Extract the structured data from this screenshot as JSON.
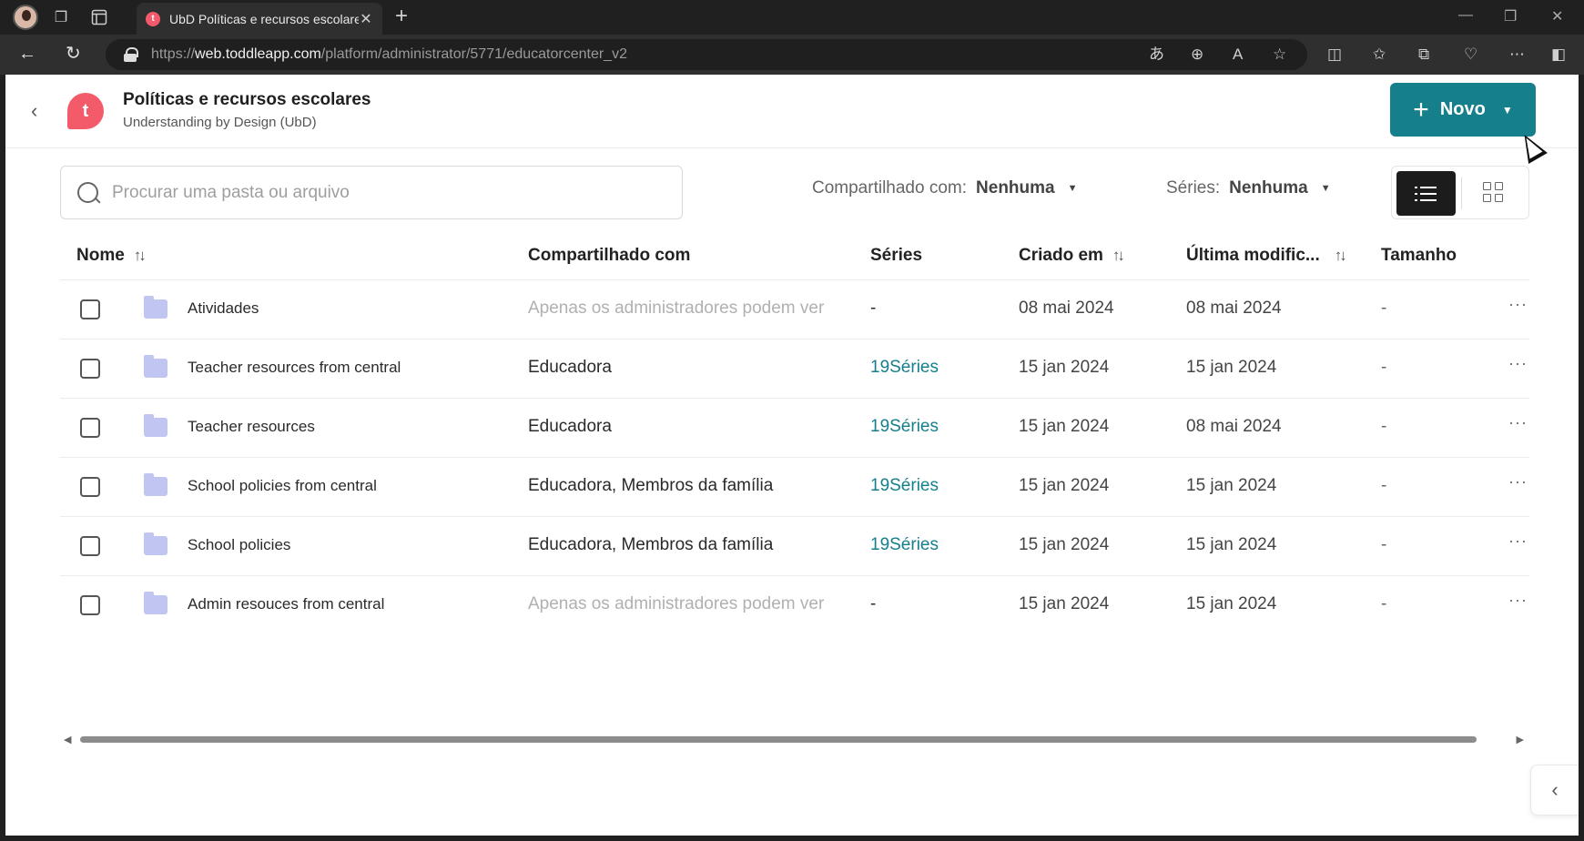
{
  "browser": {
    "tab_title": "UbD Políticas e recursos escolares",
    "tab_favicon_letter": "t",
    "url_prefix": "https://",
    "url_host": "web.toddleapp.com",
    "url_path": "/platform/administrator/5771/educatorcenter_v2"
  },
  "header": {
    "logo_letter": "t",
    "title": "Políticas e recursos escolares",
    "subtitle": "Understanding by Design (UbD)",
    "new_button_label": "Novo"
  },
  "filters": {
    "search_placeholder": "Procurar uma pasta ou arquivo",
    "shared_label": "Compartilhado com:",
    "shared_value": "Nenhuma",
    "series_label": "Séries:",
    "series_value": "Nenhuma"
  },
  "table": {
    "columns": {
      "name": "Nome",
      "shared": "Compartilhado com",
      "series": "Séries",
      "created": "Criado em",
      "modified": "Última modific...",
      "size": "Tamanho"
    },
    "rows": [
      {
        "name": "Atividades",
        "shared": "Apenas os administradores podem ver",
        "series": "-",
        "created": "08 mai 2024",
        "modified": "08 mai 2024",
        "size": "-"
      },
      {
        "name": "Teacher resources from central",
        "shared": "Educadora",
        "series": "19Séries",
        "created": "15 jan 2024",
        "modified": "15 jan 2024",
        "size": "-"
      },
      {
        "name": "Teacher resources",
        "shared": "Educadora",
        "series": "19Séries",
        "created": "15 jan 2024",
        "modified": "08 mai 2024",
        "size": "-"
      },
      {
        "name": "School policies from central",
        "shared": "Educadora, Membros da família",
        "series": "19Séries",
        "created": "15 jan 2024",
        "modified": "15 jan 2024",
        "size": "-"
      },
      {
        "name": "School policies",
        "shared": "Educadora, Membros da família",
        "series": "19Séries",
        "created": "15 jan 2024",
        "modified": "15 jan 2024",
        "size": "-"
      },
      {
        "name": "Admin resouces from central",
        "shared": "Apenas os administradores podem ver",
        "series": "-",
        "created": "15 jan 2024",
        "modified": "15 jan 2024",
        "size": "-"
      }
    ]
  },
  "colors": {
    "accent": "#157f8c",
    "logo": "#f45b6a",
    "folder": "#c1c5f2"
  }
}
